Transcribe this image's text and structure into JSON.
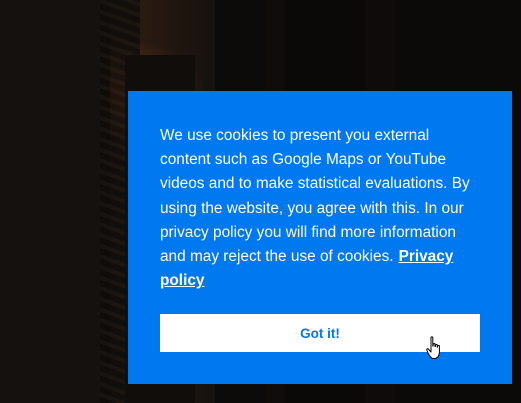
{
  "cookie_banner": {
    "message": "We use cookies to present you external content such as Google Maps or YouTube videos and to make statistical evaluations. By using the website, you agree with this. In our privacy policy you will find more information and may reject the use of cookies.",
    "privacy_link_label": "Privacy policy",
    "accept_button_label": "Got it!",
    "background_color": "#0078f0",
    "button_text_color": "#0078f0"
  },
  "cursor": {
    "icon": "hand-pointer-icon"
  }
}
